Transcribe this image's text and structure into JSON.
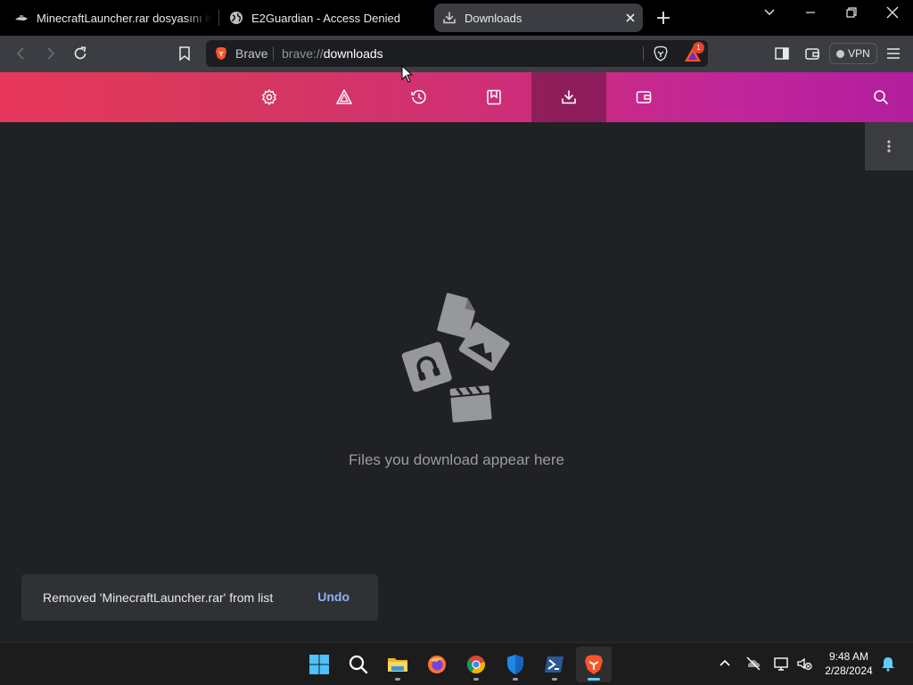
{
  "tabs": [
    {
      "title": "MinecraftLauncher.rar dosyasını indir",
      "icon": "minecraft-favicon-icon",
      "active": false
    },
    {
      "title": "E2Guardian - Access Denied",
      "icon": "globe-icon",
      "active": false
    },
    {
      "title": "Downloads",
      "icon": "download-icon",
      "active": true
    }
  ],
  "toolbar": {
    "brand": "Brave",
    "url_scheme": "brave://",
    "url_host": "downloads",
    "rewards_badge": "1",
    "vpn_label": "VPN"
  },
  "nav": {
    "items": [
      "settings-icon",
      "rewards-triangle-icon",
      "history-icon",
      "bookmarks-icon",
      "download-icon",
      "wallet-icon"
    ],
    "active": "download-icon"
  },
  "page": {
    "empty_message": "Files you download appear here"
  },
  "toast": {
    "message": "Removed 'MinecraftLauncher.rar' from list",
    "action": "Undo"
  },
  "taskbar": {
    "apps": [
      "start",
      "search",
      "file-explorer",
      "firefox",
      "chrome",
      "windows-security",
      "terminal",
      "brave"
    ],
    "active": "brave",
    "time": "9:48 AM",
    "date": "2/28/2024"
  },
  "colors": {
    "accent_gradient_start": "#e8375c",
    "accent_gradient_end": "#b21e9e",
    "link": "#8ab4f8",
    "background": "#202124"
  }
}
